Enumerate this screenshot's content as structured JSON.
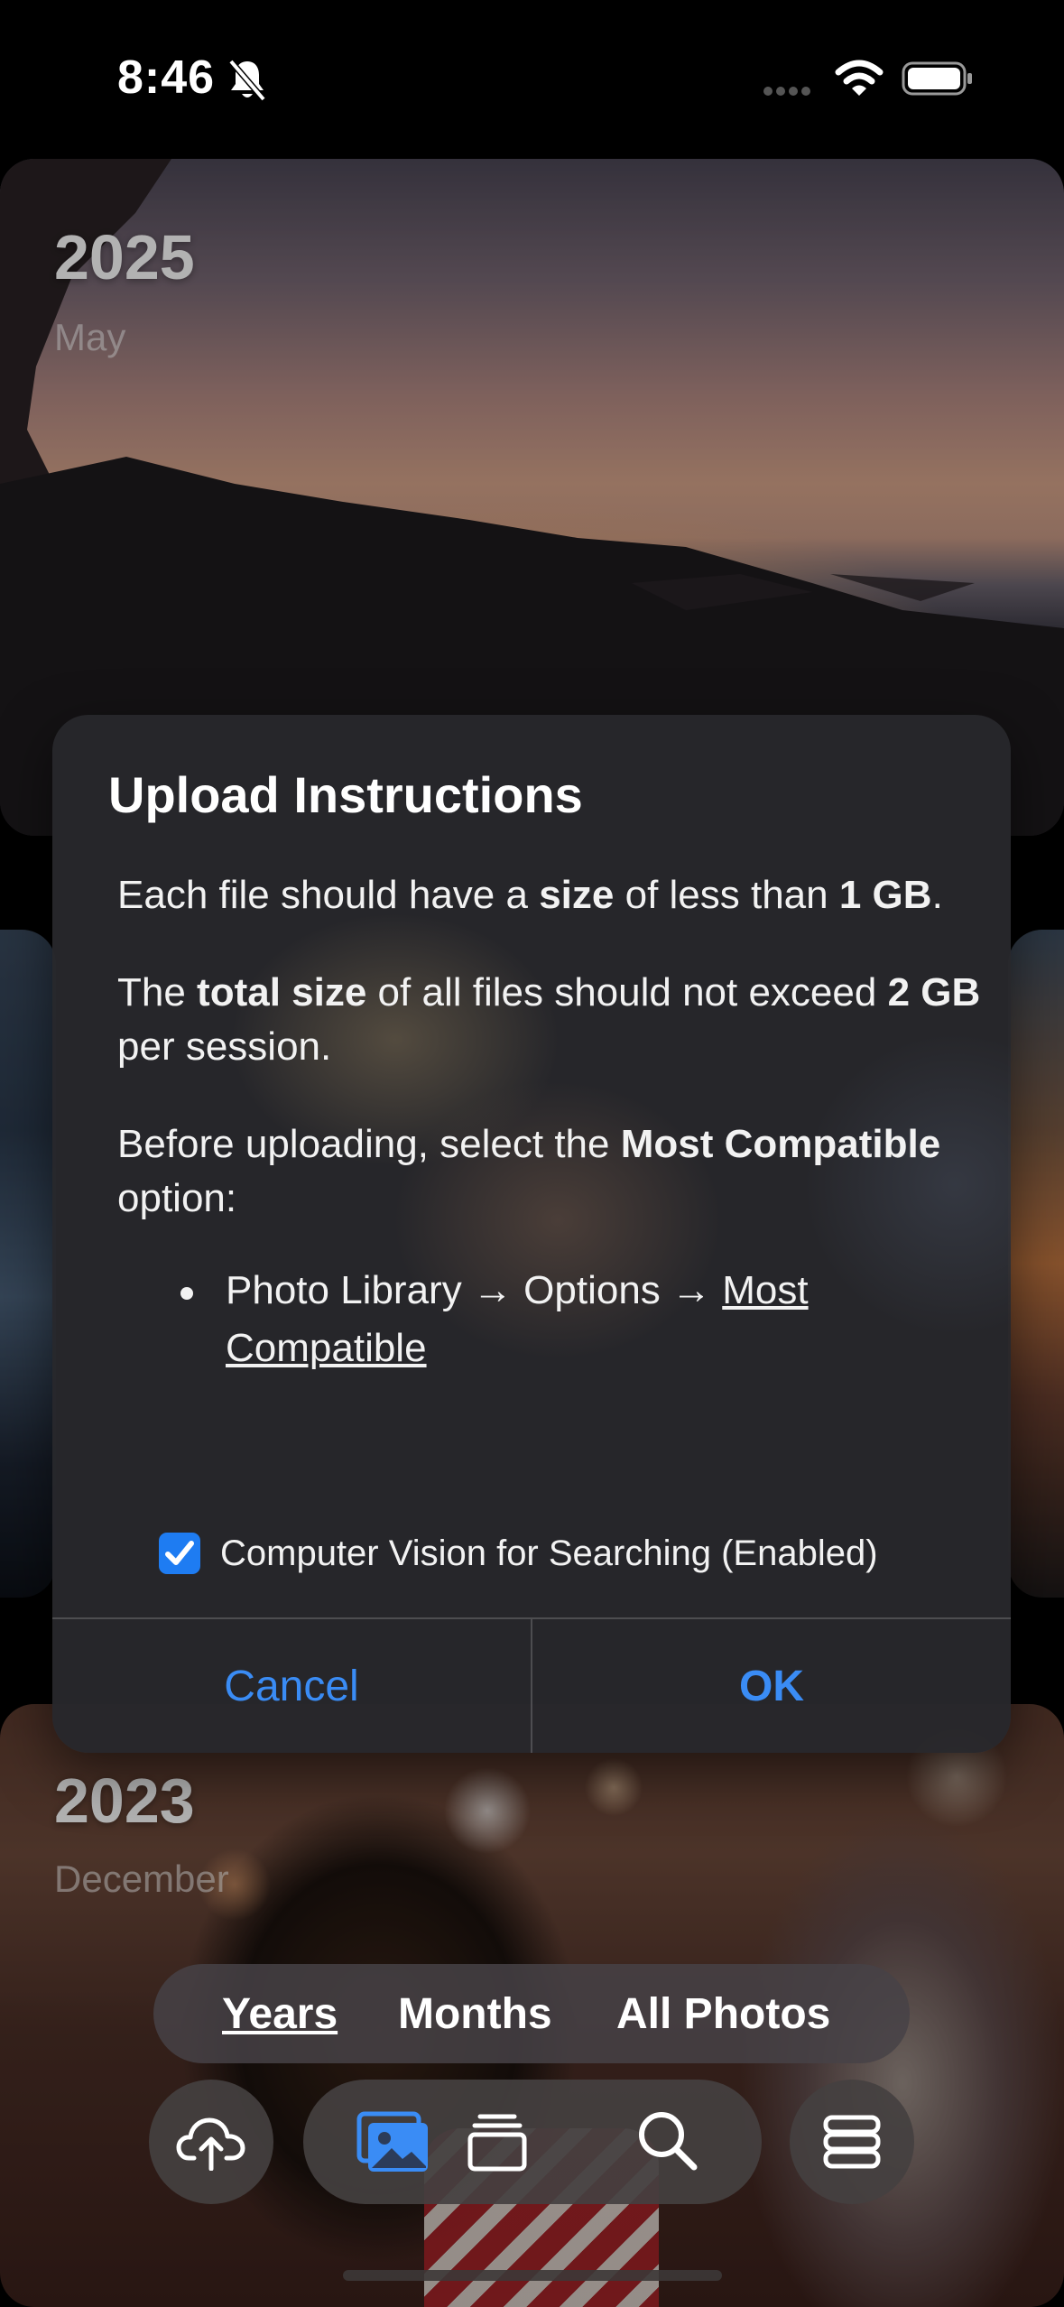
{
  "status_bar": {
    "time": "8:46"
  },
  "timeline": [
    {
      "year": "2025",
      "month": "May"
    },
    {
      "year": "2023",
      "month": "December"
    }
  ],
  "dialog": {
    "title": "Upload Instructions",
    "p1": {
      "t1": "Each file should have a ",
      "b1": "size",
      "t2": " of less than ",
      "b2": "1 GB",
      "t3": "."
    },
    "p2": {
      "t1": "The ",
      "b1": "total size",
      "t2": " of all files should not exceed ",
      "b2": "2 GB",
      "t3": " per session."
    },
    "p3": {
      "t1": "Before uploading, select the ",
      "b1": "Most Compatible",
      "t2": " option:"
    },
    "bullet": {
      "t1": "Photo Library → Options → ",
      "u1": "Most Compatible"
    },
    "checkbox_label": "Computer Vision for Searching (Enabled)",
    "checkbox_checked": true,
    "cancel_label": "Cancel",
    "ok_label": "OK"
  },
  "view_switcher": {
    "years": "Years",
    "months": "Months",
    "all_photos": "All Photos",
    "selected": "Years"
  },
  "toolbar": {
    "icons": [
      "upload-cloud-icon",
      "photos-icon",
      "albums-icon",
      "search-icon",
      "storage-menu-icon"
    ],
    "active": "photos-icon"
  },
  "colors": {
    "accent": "#3A8CF5",
    "checkbox": "#1E7CF2",
    "dialog_bg": "#28282C"
  }
}
